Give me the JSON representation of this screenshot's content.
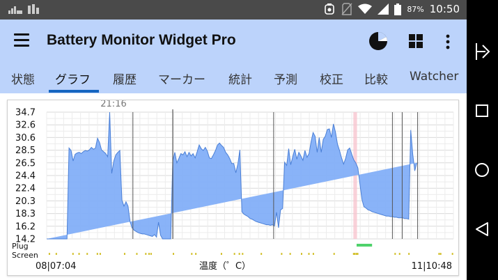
{
  "status_bar": {
    "left_icons": [
      "signal-speed-icon",
      "bar-chart-icon"
    ],
    "right_icons": [
      "battery-monitor-icon",
      "no-sim-icon",
      "wifi-icon",
      "cell-signal-icon",
      "battery-icon"
    ],
    "battery_percent": "87%",
    "time": "10:50"
  },
  "app_bar": {
    "title": "Battery Monitor Widget Pro",
    "icons": [
      "menu-icon",
      "pie-chart-icon",
      "grid-icon",
      "more-vert-icon"
    ]
  },
  "tabs": [
    {
      "label": "状態",
      "active": false
    },
    {
      "label": "グラフ",
      "active": true
    },
    {
      "label": "履歴",
      "active": false
    },
    {
      "label": "マーカー",
      "active": false
    },
    {
      "label": "統計",
      "active": false
    },
    {
      "label": "予測",
      "active": false
    },
    {
      "label": "校正",
      "active": false
    },
    {
      "label": "比較",
      "active": false
    },
    {
      "label": "Watcher",
      "active": false
    }
  ],
  "chart_data": {
    "type": "area",
    "y_ticks": [
      "34.7",
      "32.6",
      "30.6",
      "28.5",
      "26.5",
      "24.4",
      "22.4",
      "20.3",
      "18.3",
      "16.2",
      "14.2"
    ],
    "ylim": [
      14.2,
      34.7
    ],
    "grid": true,
    "fill_color": "#7fadf7",
    "line_color": "#4a7fd6",
    "marker_label": "21:16",
    "x_start_label": "08|07:04",
    "x_end_label": "11|10:48",
    "xlabel": "温度（゜C）",
    "row_labels": [
      "Plug",
      "Screen"
    ],
    "x": [
      0,
      0.4,
      1,
      1.5,
      2,
      2.5,
      3,
      3.5,
      4,
      4.5,
      5,
      5.5,
      6,
      6.5,
      7,
      7.5,
      8,
      8.5,
      9,
      9.5,
      10,
      10.5,
      11,
      11.5,
      12,
      12.5,
      13,
      13.5,
      14,
      14.5,
      15,
      15.5,
      16,
      16.5,
      17,
      17.5,
      18,
      18.5,
      19,
      19.5,
      20,
      20.5,
      21,
      21.5,
      22,
      22.5,
      23,
      23.5,
      24,
      24.5,
      25,
      25.5,
      26,
      26.5,
      27,
      27.5,
      28,
      28.5,
      29,
      29.5,
      30,
      30.5,
      31,
      31.5,
      32,
      32.5,
      33,
      33.5,
      34,
      34.5,
      35,
      35.5,
      36,
      36.5,
      37,
      37.5,
      38,
      38.5,
      39,
      39.5,
      40,
      40.5,
      41,
      41.5,
      42,
      42.5,
      43,
      43.5,
      44,
      44.5,
      45,
      45.5,
      46,
      46.5,
      47,
      47.5,
      48,
      48.5,
      49,
      49.5,
      50,
      50.5,
      51,
      51.5,
      52,
      52.5,
      53,
      53.5,
      54,
      54.5,
      55,
      55.5,
      56,
      56.5,
      57,
      57.5,
      58,
      58.5,
      59,
      59.5,
      60,
      60.5,
      61,
      61.5,
      62,
      62.5,
      63,
      63.5,
      64,
      64.5,
      65,
      65.5,
      66,
      66.5,
      67,
      67.5,
      68,
      68.5,
      69,
      69.5,
      70,
      70.5,
      71,
      71.5,
      72,
      72.5,
      73,
      73.5,
      74,
      74.5,
      75,
      75.5,
      76,
      76.5,
      77,
      77.5,
      78,
      78.5,
      79,
      79.5,
      80,
      80.5,
      81,
      81.5,
      82,
      82.5,
      83,
      83.5,
      84,
      84.5,
      85,
      85.5,
      86,
      86.5,
      87,
      87.5,
      88,
      88.5,
      89,
      89.5,
      90,
      90.5,
      91,
      91.5,
      92,
      92.5,
      93,
      93.5,
      94,
      94.5,
      95,
      95.5,
      96,
      96.5,
      97,
      97.5,
      98,
      98.5,
      99,
      99.5,
      100
    ],
    "values": [
      14.2,
      14.2,
      14.2,
      14.2,
      14.2,
      14.2,
      14.2,
      14.2,
      14.2,
      14.2,
      14.2,
      28.9,
      28.5,
      26.8,
      27.9,
      28.1,
      28.2,
      28.0,
      28.3,
      28.5,
      28.4,
      28.6,
      29.0,
      28.7,
      28.9,
      30.5,
      29.8,
      28.6,
      28.3,
      28.0,
      27.5,
      34.7,
      24.8,
      26.8,
      27.8,
      28.2,
      28.5,
      20.5,
      19.5,
      20.2,
      19.5,
      17.0,
      16.0,
      15.6,
      15.4,
      15.2,
      15.1,
      15.0,
      15.0,
      14.9,
      14.8,
      14.7,
      14.6,
      14.9,
      14.5,
      16.9,
      14.8,
      14.2,
      14.2,
      14.2,
      14.2,
      14.2,
      26.8,
      28.2,
      26.5,
      27.2,
      28.0,
      27.8,
      28.3,
      27.5,
      28.2,
      27.6,
      28.0,
      27.3,
      28.3,
      29.4,
      28.8,
      28.5,
      29.0,
      28.4,
      27.3,
      27.2,
      27.8,
      28.5,
      29.4,
      29.7,
      29.3,
      29.0,
      28.2,
      27.8,
      27.2,
      26.4,
      26.4,
      24.9,
      26.3,
      28.6,
      18.6,
      18.2,
      18.0,
      17.8,
      17.5,
      17.4,
      17.2,
      17.0,
      16.9,
      16.8,
      16.7,
      16.6,
      16.5,
      16.5,
      16.4,
      16.5,
      16.3,
      18.5,
      16.0,
      18.9,
      19.1,
      26.6,
      26.1,
      28.8,
      26.2,
      27.5,
      28.7,
      27.1,
      28.2,
      27.6,
      26.9,
      28.5,
      27.4,
      28.0,
      29.9,
      31.4,
      30.8,
      28.2,
      30.6,
      28.2,
      30.3,
      30.8,
      31.9,
      32.0,
      30.6,
      32.8,
      31.5,
      29.5,
      28.5,
      27.3,
      26.3,
      27.2,
      28.6,
      28.9,
      27.9,
      27.0,
      26.5,
      25.7,
      23.1,
      20.6,
      19.4,
      19.2,
      18.9,
      18.8,
      18.6,
      18.5,
      18.4,
      18.3,
      18.2,
      18.1,
      18.0,
      17.9,
      17.9,
      17.8,
      17.8,
      17.7,
      17.7,
      17.6,
      17.6,
      17.6,
      17.5,
      17.5,
      17.4,
      31.8,
      27.9,
      25.2,
      26.5
    ],
    "vertical_lines_x": [
      21.2,
      55.8,
      85.0,
      87.4,
      91.2
    ],
    "highlight_band_x": [
      75.4,
      76.3
    ],
    "plug_bar_x": [
      76.2,
      80.0
    ],
    "screen_ticks_x": [
      0.5,
      2.2,
      6.3,
      7.8,
      9.8,
      12.3,
      13.0,
      19.0,
      22.0,
      24.2,
      25.0,
      25.5,
      31.0,
      35.5,
      36.5,
      42.8,
      46.0,
      47.2,
      48.0,
      52.6,
      57.6,
      59.7,
      62.5,
      64.3,
      65.4,
      70.5,
      75.3,
      75.6,
      76.0,
      76.3,
      85.5,
      86.6,
      88.9,
      96.3,
      96.7,
      99.6
    ]
  },
  "nav_bar": {
    "icons": [
      "notification-pull-icon",
      "overview-square-icon",
      "home-circle-icon",
      "back-triangle-icon"
    ]
  }
}
